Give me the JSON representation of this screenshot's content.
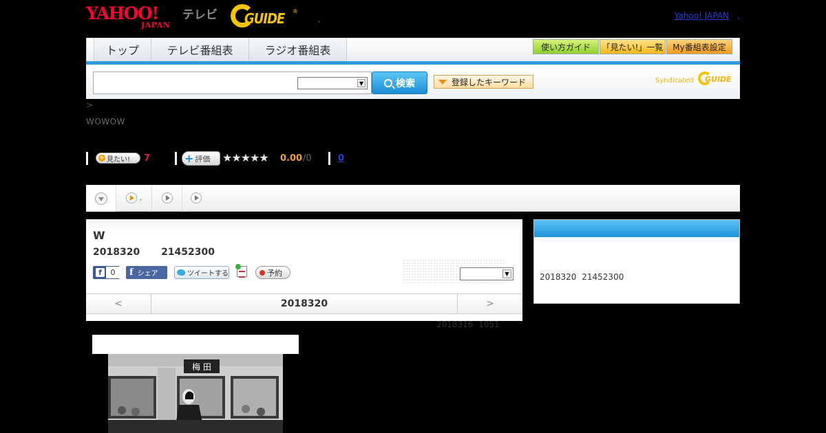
{
  "header": {
    "brand_main": "YAHOO!",
    "brand_sub": "JAPAN",
    "tv_label": "テレビ",
    "gguide_text": "GUIDE",
    "gguide_reg": "®",
    "dot": ",",
    "yahoo_japan_link": "Yahoo! JAPAN",
    "link_dot": ","
  },
  "nav": {
    "tabs": [
      "トップ",
      "テレビ番組表",
      "ラジオ番組表"
    ],
    "guide_label": "使い方ガイド",
    "wishlist_label": "「見たい!」一覧",
    "myprog_label": "My番組表設定"
  },
  "search": {
    "placeholder": "",
    "select_value": "",
    "button_label": "検索",
    "keyword_label": "登録したキーワード",
    "syndicated_text": "Syndicated",
    "syndicated_logo": "GUIDE"
  },
  "breadcrumb": ">",
  "channel": "WOWOW",
  "actions": {
    "want_label": "見たい!",
    "want_count": "7",
    "rate_label": "評価",
    "stars": "★★★★★",
    "rating_score": "0.00",
    "rating_count": "/0",
    "review_count": "0"
  },
  "tabstrip": {
    "tab2_label": ","
  },
  "program": {
    "title": "W",
    "datetime": "2018320 21452300",
    "fb_like_count": "0",
    "fb_f": "f",
    "fb_share_label": "シェア",
    "tweet_label": "ツイートする",
    "reserve_label": "予約",
    "date_prev": "<",
    "date_current": "2018320",
    "date_next": ">"
  },
  "update_time": "2018316 1051",
  "side": {
    "text": "2018320 21452300"
  },
  "image": {
    "sign_text": "梅 田"
  }
}
